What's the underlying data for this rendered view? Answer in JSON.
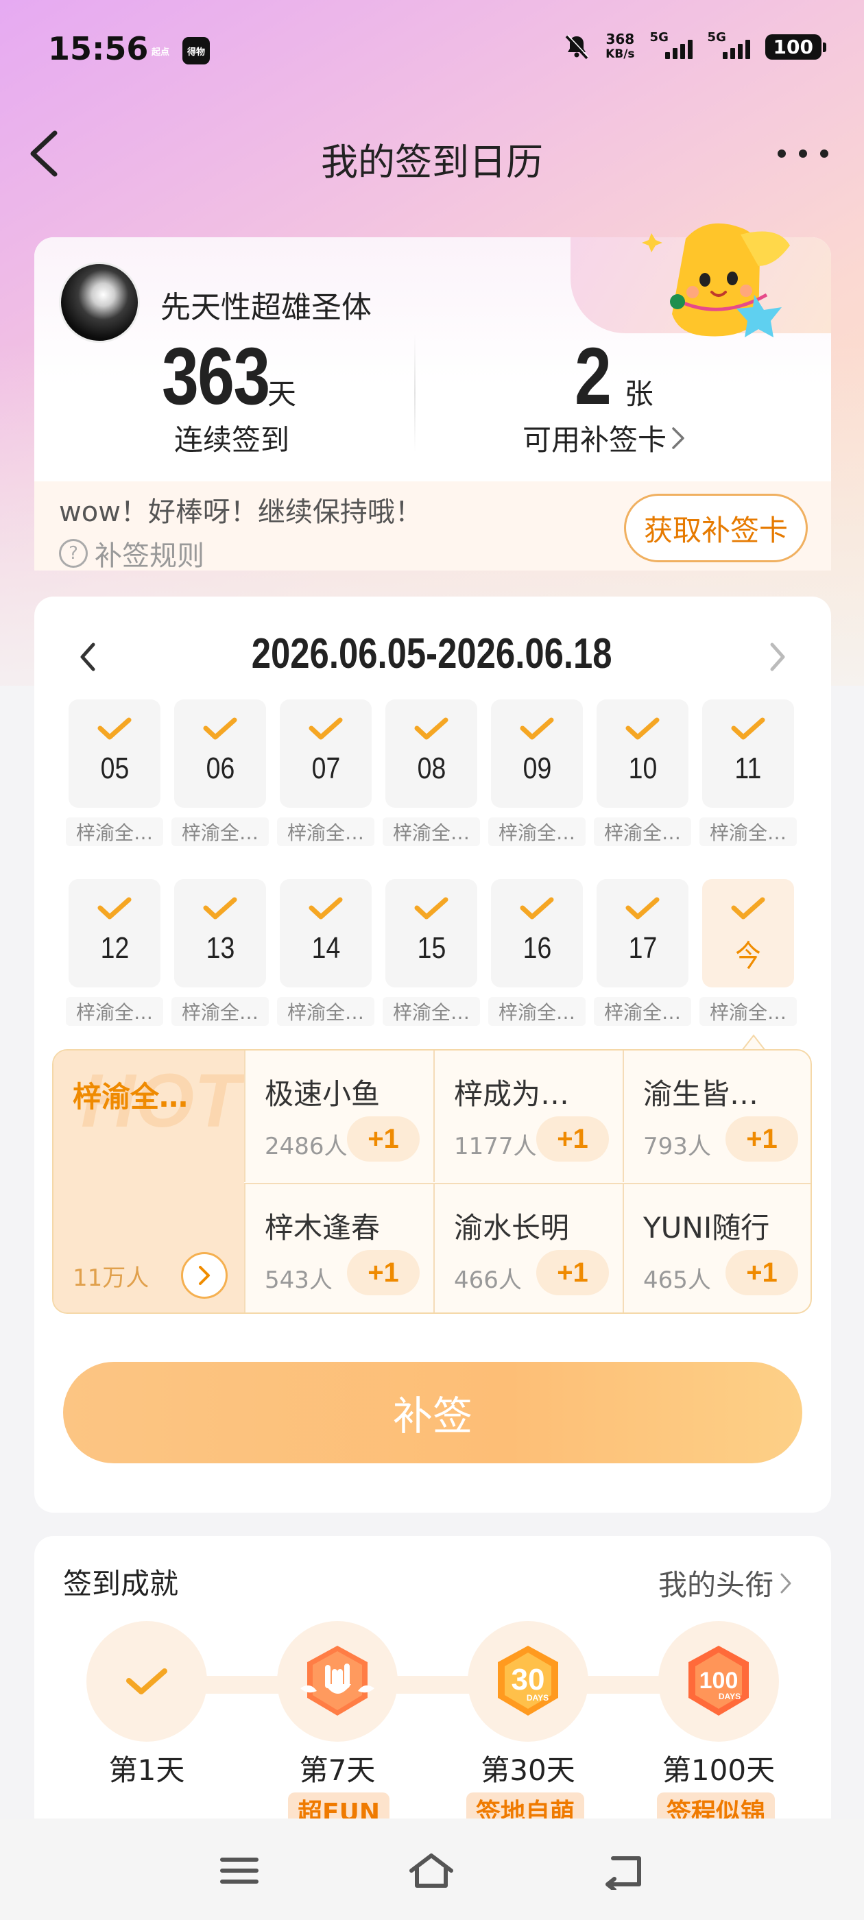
{
  "status_bar": {
    "time": "15:56",
    "app_badges": [
      {
        "text": "起点",
        "color": "#f0143c"
      },
      {
        "text": "得物",
        "color": "#1a1a1a"
      }
    ],
    "net_speed_value": "368",
    "net_speed_unit": "KB/s",
    "network_1": "5G",
    "network_2": "5G",
    "battery": "100"
  },
  "nav": {
    "title": "我的签到日历"
  },
  "user": {
    "name": "先天性超雄圣体",
    "streak_value": "363",
    "streak_unit": "天",
    "streak_label": "连续签到",
    "cards_value": "2",
    "cards_unit": "张",
    "cards_label": "可用补签卡",
    "encourage": "wow！好棒呀！继续保持哦！",
    "rules_link": "补签规则",
    "get_card_button": "获取补签卡"
  },
  "calendar": {
    "range": "2026.06.05-2026.06.18",
    "days": [
      {
        "num": "05",
        "tag": "梓渝全…",
        "checked": true
      },
      {
        "num": "06",
        "tag": "梓渝全…",
        "checked": true
      },
      {
        "num": "07",
        "tag": "梓渝全…",
        "checked": true
      },
      {
        "num": "08",
        "tag": "梓渝全…",
        "checked": true
      },
      {
        "num": "09",
        "tag": "梓渝全…",
        "checked": true
      },
      {
        "num": "10",
        "tag": "梓渝全…",
        "checked": true
      },
      {
        "num": "11",
        "tag": "梓渝全…",
        "checked": true
      },
      {
        "num": "12",
        "tag": "梓渝全…",
        "checked": true
      },
      {
        "num": "13",
        "tag": "梓渝全…",
        "checked": true
      },
      {
        "num": "14",
        "tag": "梓渝全…",
        "checked": true
      },
      {
        "num": "15",
        "tag": "梓渝全…",
        "checked": true
      },
      {
        "num": "16",
        "tag": "梓渝全…",
        "checked": true
      },
      {
        "num": "17",
        "tag": "梓渝全…",
        "checked": true
      },
      {
        "num": "今",
        "tag": "梓渝全…",
        "checked": true,
        "today": true
      }
    ]
  },
  "ranking": {
    "watermark": "HOT",
    "first": {
      "name": "梓渝全…",
      "count": "11万人"
    },
    "others": [
      {
        "name": "极速小鱼",
        "count": "2486人",
        "action": "+1"
      },
      {
        "name": "梓成为…",
        "count": "1177人",
        "action": "+1"
      },
      {
        "name": "渝生皆…",
        "count": "793人",
        "action": "+1"
      },
      {
        "name": "梓木逢春",
        "count": "543人",
        "action": "+1"
      },
      {
        "name": "渝水长明",
        "count": "466人",
        "action": "+1"
      },
      {
        "name": "YUNI随行",
        "count": "465人",
        "action": "+1"
      }
    ]
  },
  "makeup_button": "补签",
  "achievements": {
    "title": "签到成就",
    "my_titles_link": "我的头衔",
    "items": [
      {
        "label": "第1天",
        "badge": ""
      },
      {
        "label": "第7天",
        "badge": "超FUN"
      },
      {
        "label": "第30天",
        "badge": "签地自萌"
      },
      {
        "label": "第100天",
        "badge": "签程似锦"
      }
    ],
    "badge_30_text": "30",
    "badge_100_text": "100",
    "badge_days_text": "DAYS"
  },
  "colors": {
    "accent": "#f08c00",
    "check": "#f5a623"
  }
}
